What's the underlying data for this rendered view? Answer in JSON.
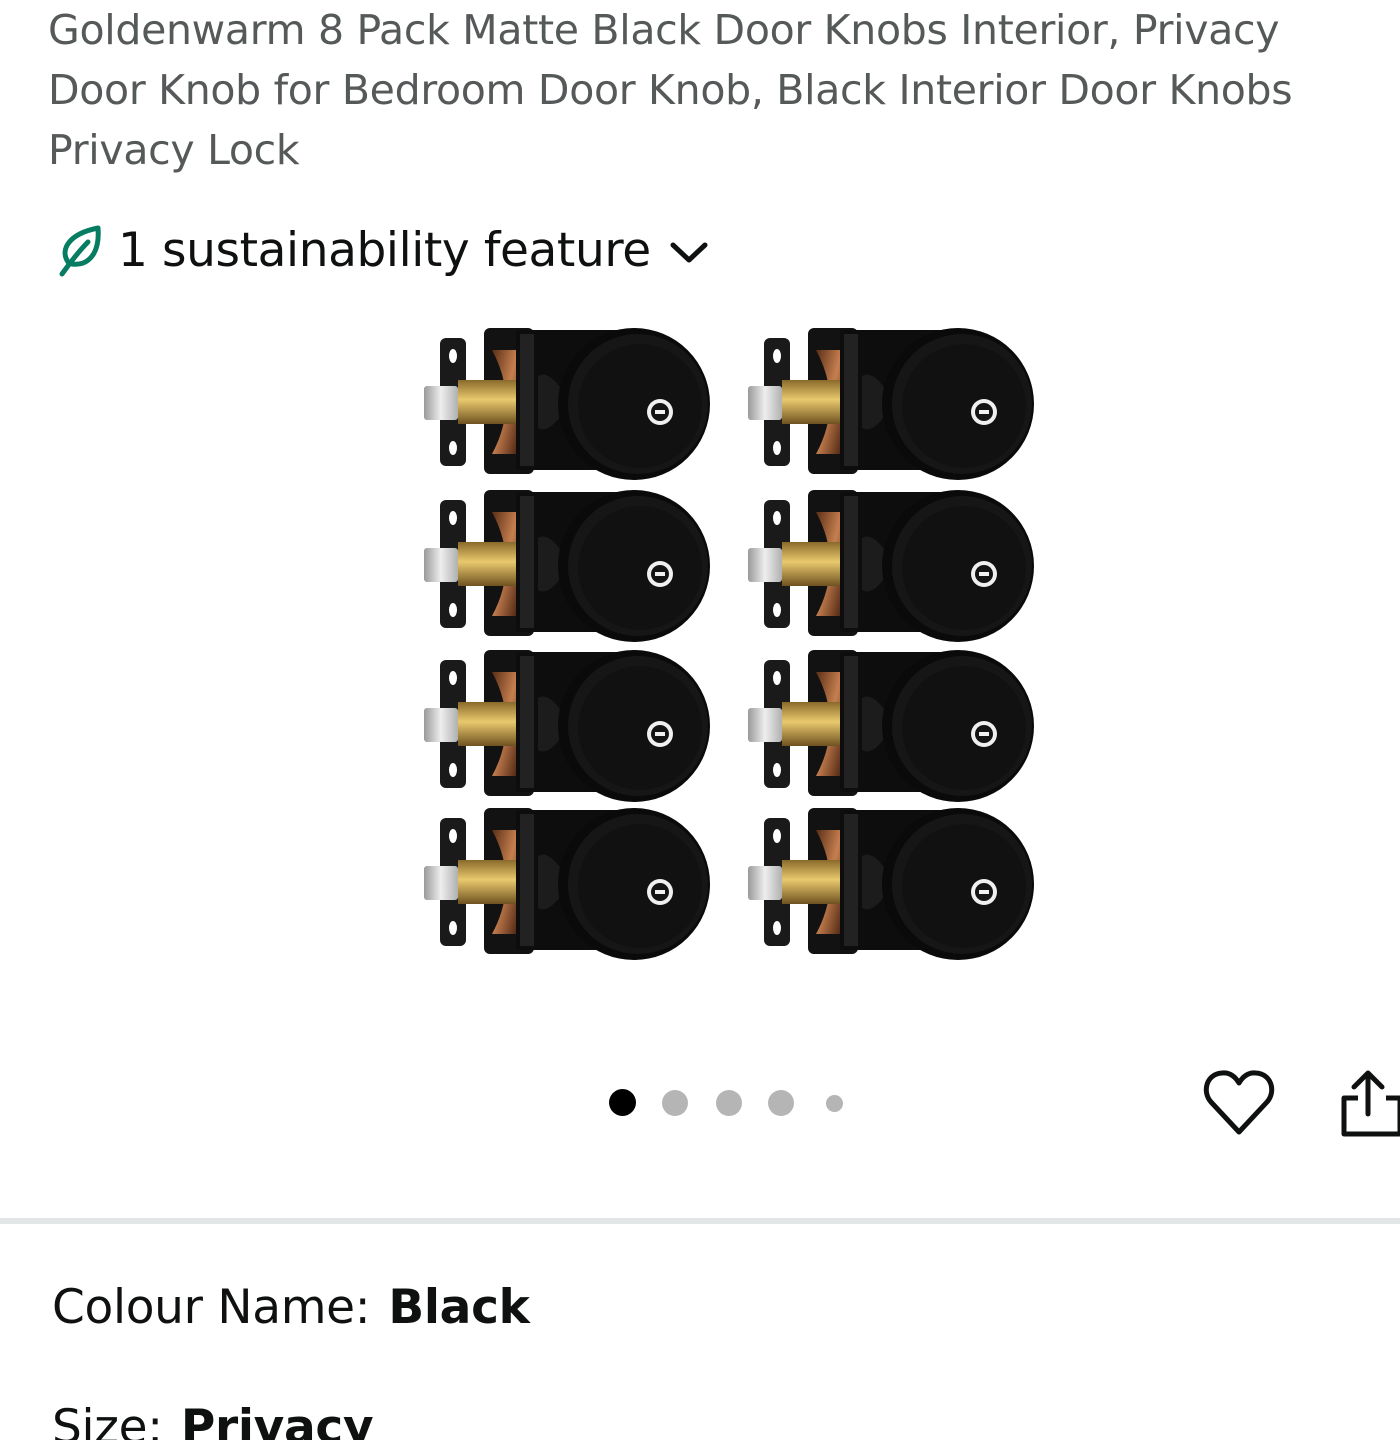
{
  "product": {
    "title": "Goldenwarm 8 Pack Matte Black Door Knobs Interior, Privacy Door Knob for Bedroom Door Knob, Black Interior Door Knobs Privacy Lock"
  },
  "sustainability": {
    "label": "1 sustainability feature",
    "icon": "leaf-icon",
    "accent_color": "#067d62"
  },
  "gallery": {
    "image_count": 5,
    "active_index": 0
  },
  "actions": {
    "wishlist_icon": "heart-icon",
    "share_icon": "share-icon"
  },
  "variations": {
    "colour": {
      "label": "Colour Name:",
      "value": "Black"
    },
    "size": {
      "label": "Size:",
      "value": "Privacy"
    }
  }
}
